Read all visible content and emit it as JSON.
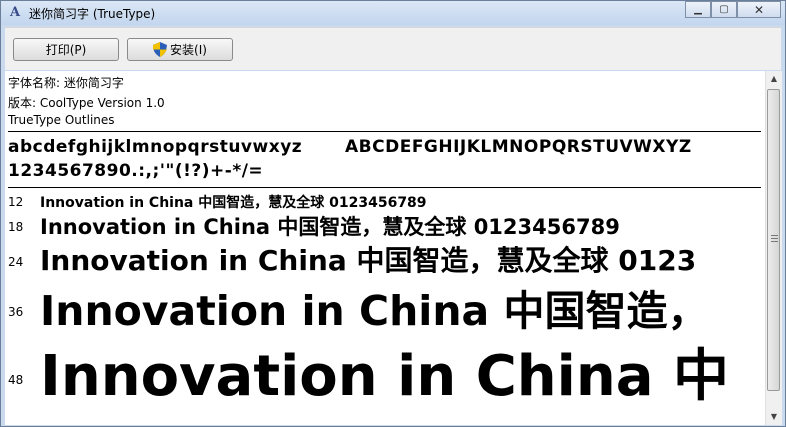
{
  "window": {
    "title": "迷你简习字 (TrueType)",
    "app_icon_glyph": "A",
    "controls": {
      "minimize": "▁",
      "maximize": "▢",
      "close": "✕"
    }
  },
  "toolbar": {
    "print_label": "打印(P)",
    "install_label": "安装(I)"
  },
  "info": {
    "font_name_line": "字体名称: 迷你简习字",
    "version_line": "版本: CoolType Version 1.0",
    "outline_line": "TrueType Outlines"
  },
  "charset": {
    "lower": "abcdefghijklmnopqrstuvwxyz",
    "upper": "ABCDEFGHIJKLMNOPQRSTUVWXYZ",
    "digits_punct": "1234567890.:,;'\"(!?)+-*/="
  },
  "samples": [
    {
      "size": "12",
      "text": "Innovation in China 中国智造，慧及全球 0123456789"
    },
    {
      "size": "18",
      "text": "Innovation in China 中国智造，慧及全球 0123456789"
    },
    {
      "size": "24",
      "text": "Innovation in China 中国智造，慧及全球 0123"
    },
    {
      "size": "36",
      "text": "Innovation in China 中国智造，"
    },
    {
      "size": "48",
      "text": "Innovation in China 中"
    },
    {
      "size": "60",
      "text": ""
    }
  ],
  "scrollbar": {
    "up": "▲",
    "down": "▼"
  }
}
